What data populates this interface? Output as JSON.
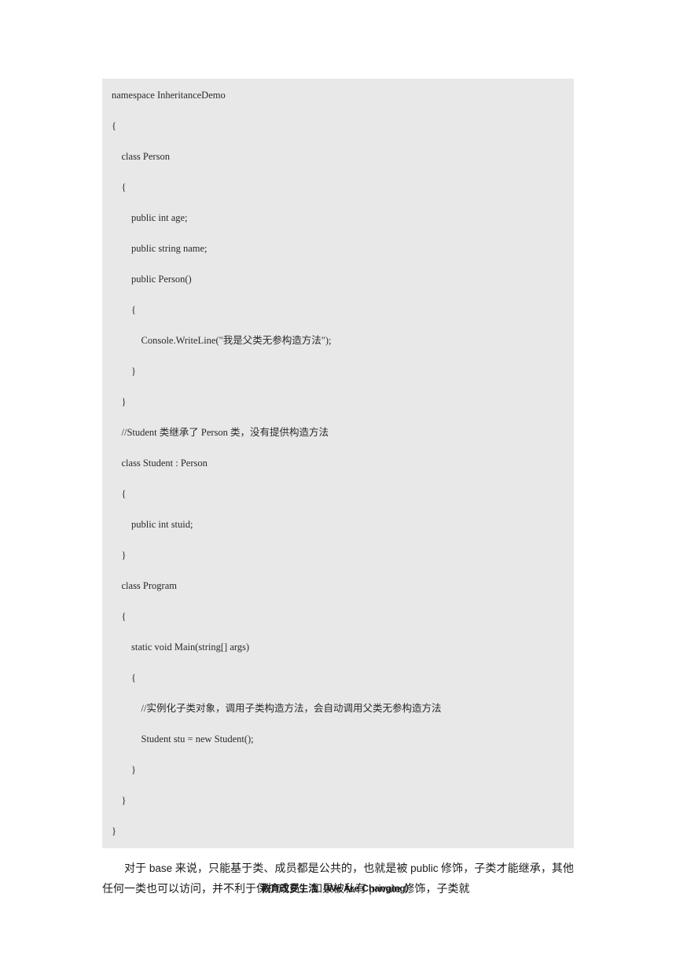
{
  "code": {
    "lines": [
      "namespace InheritanceDemo",
      "{",
      "    class Person",
      "    {",
      "        public int age;",
      "        public string name;",
      "        public Person()",
      "        {",
      "            Console.WriteLine(\"我是父类无参构造方法\");",
      "        }",
      "    }",
      "",
      "    //Student 类继承了 Person 类，没有提供构造方法",
      "    class Student : Person",
      "    {",
      "        public int stuid;",
      "    }",
      "",
      "    class Program",
      "    {",
      "        static void Main(string[] args)",
      "        {",
      "            //实例化子类对象，调用子类构造方法，会自动调用父类无参构造方法",
      "            Student stu = new Student();",
      "        }",
      "    }",
      "}"
    ]
  },
  "paragraph": {
    "text_before_base": "对于 ",
    "base": "base",
    "text_after_base": " 来说，只能基于类、成员都是公共的，也就是被 ",
    "public": "public",
    "text_after_public": " 修饰，子类才能继承，其他任何一类也可以访问，并不利于保护成员，如果被私有 ",
    "private": "private",
    "text_after_private": " 修饰，子类就"
  },
  "footer": {
    "cn": "教育改变生活",
    "paren_open": "（",
    "en": "We Are Changing",
    "paren_close": "）"
  }
}
